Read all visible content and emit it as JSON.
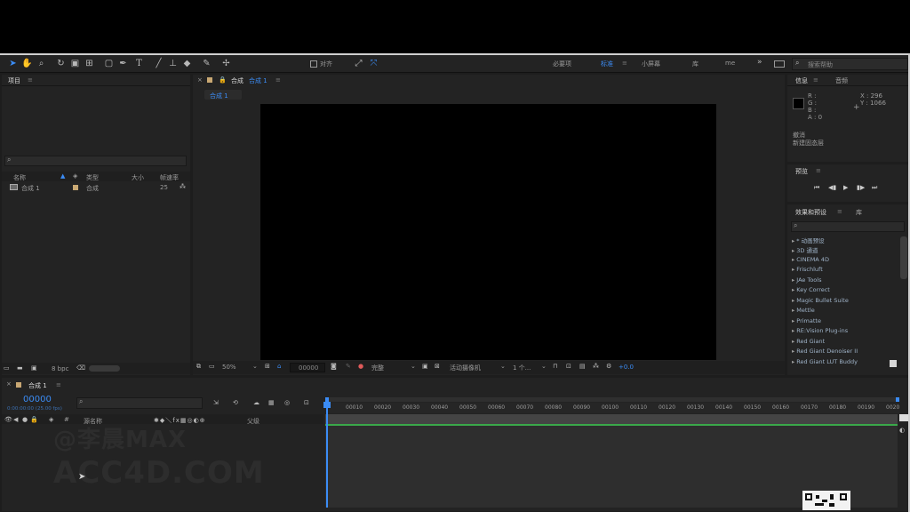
{
  "toolbar": {
    "snap_label": "对齐",
    "workspaces": [
      "必要项",
      "标准",
      "小屏幕",
      "库",
      "me"
    ],
    "active_workspace_index": 1,
    "search_placeholder": "搜索帮助"
  },
  "project": {
    "title": "项目",
    "menu": "≡",
    "columns": {
      "name": "名称",
      "type": "类型",
      "size": "大小",
      "fps": "帧速率"
    },
    "items": [
      {
        "name": "合成 1",
        "type": "合成",
        "fps": "25"
      }
    ],
    "bpc": "8 bpc"
  },
  "composition": {
    "tab_title": "合成",
    "tab_name": "合成 1",
    "menu": "≡",
    "breadcrumb": "合成 1",
    "zoom": "50%",
    "timecode": "00000",
    "resolution": "完整",
    "camera": "活动摄像机",
    "views": "1 个...",
    "exposure": "+0.0"
  },
  "info": {
    "tab_info": "信息",
    "tab_audio": "音频",
    "menu": "≡",
    "rgba": [
      "R :",
      "G :",
      "B :",
      "A : 0"
    ],
    "x": "X : 296",
    "y": "Y : 1066",
    "undo_title": "撤消",
    "undo_action": "新建固态层"
  },
  "preview": {
    "title": "预览",
    "menu": "≡"
  },
  "effects": {
    "tab": "效果和预设",
    "menu": "≡",
    "tab_library": "库",
    "items": [
      "* 动画预设",
      "3D 通道",
      "CINEMA 4D",
      "Frischluft",
      "JAe Tools",
      "Key Correct",
      "Magic Bullet Suite",
      "Mettle",
      "Primatte",
      "RE:Vision Plug-ins",
      "Red Giant",
      "Red Giant Denoiser II",
      "Red Giant LUT Buddy"
    ]
  },
  "timeline": {
    "tab": "合成 1",
    "menu": "≡",
    "timecode": "00000",
    "timecode_sub": "0:00:00:00 (25.00 fps)",
    "col_source_name": "源名称",
    "col_parent": "父级",
    "ruler": [
      "00010",
      "00020",
      "00030",
      "00040",
      "00050",
      "00060",
      "00070",
      "00080",
      "00090",
      "00100",
      "00110",
      "00120",
      "00130",
      "00140",
      "00150",
      "00160",
      "00170",
      "00180",
      "00190",
      "0020"
    ]
  },
  "watermark": {
    "line1": "@李晨MAX",
    "line2": "ACC4D.COM"
  },
  "colors": {
    "accent": "#3b8cf5",
    "panel": "#232323",
    "bg": "#1d1d1d"
  }
}
